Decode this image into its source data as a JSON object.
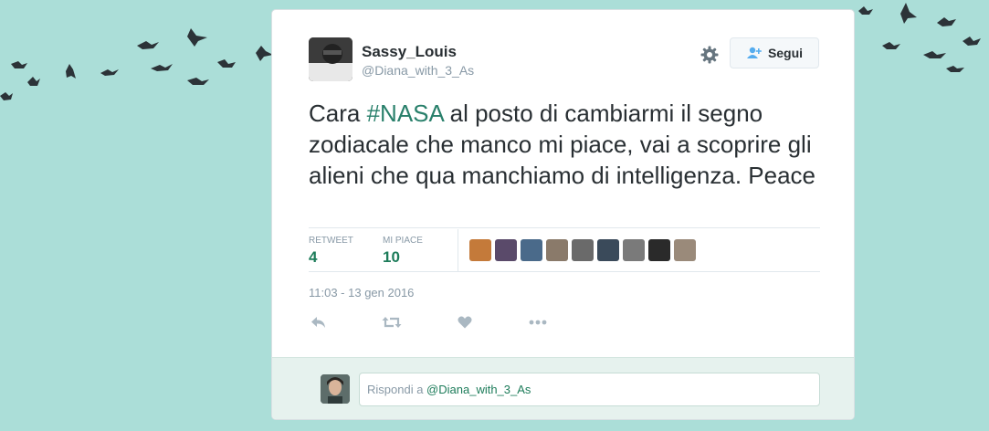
{
  "tweet": {
    "author_name": "Sassy_Louis",
    "author_handle": "@Diana_with_3_As",
    "follow_label": "Segui",
    "text_before": "Cara ",
    "hashtag": "#NASA",
    "text_after": " al posto di cambiarmi il segno zodiacale che manco mi piace, vai a scoprire gli alieni che qua manchiamo di intelligenza. Peace",
    "retweets_label": "RETWEET",
    "retweets_count": "4",
    "likes_label": "MI PIACE",
    "likes_count": "10",
    "timestamp": "11:03 - 13 gen 2016"
  },
  "likers": [
    {
      "name": "liker-1",
      "color": "#c47a3a"
    },
    {
      "name": "liker-2",
      "color": "#5a4a6a"
    },
    {
      "name": "liker-3",
      "color": "#4a6a8a"
    },
    {
      "name": "liker-4",
      "color": "#8a7a6a"
    },
    {
      "name": "liker-5",
      "color": "#6a6a6a"
    },
    {
      "name": "liker-6",
      "color": "#3a4a5a"
    },
    {
      "name": "liker-7",
      "color": "#7a7a7a"
    },
    {
      "name": "liker-8",
      "color": "#2a2a2a"
    },
    {
      "name": "liker-9",
      "color": "#9a8a7a"
    }
  ],
  "actions": [
    "reply-icon",
    "retweet-icon",
    "like-icon",
    "more-icon"
  ],
  "reply": {
    "prefix": "Rispondi a ",
    "mention": "@Diana_with_3_As"
  },
  "colors": {
    "background": "#abded8",
    "accent": "#1d7c5a",
    "birds": "#2c3338"
  }
}
